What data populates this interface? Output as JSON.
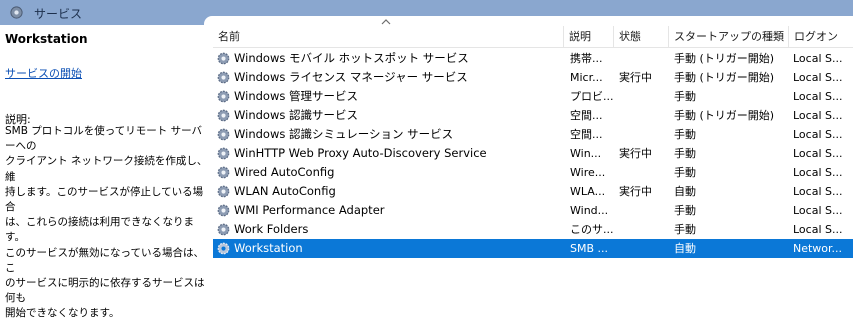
{
  "window": {
    "title": "サービス"
  },
  "left_panel": {
    "service_name": "Workstation",
    "start_link": "サービスの開始",
    "description_label": "説明:",
    "description": "SMB プロトコルを使ってリモート サーバーへの\nクライアント ネットワーク接続を作成し、維\n持します。このサービスが停止している場合\nは、これらの接続は利用できなくなります。\nこのサービスが無効になっている場合は、こ\nのサービスに明示的に依存するサービスは何も\n開始できなくなります。"
  },
  "table": {
    "columns": {
      "name": "名前",
      "description": "説明",
      "state": "状態",
      "startup": "スタートアップの種類",
      "logon": "ログオン"
    },
    "rows": [
      {
        "name": "Windows モバイル ホットスポット サービス",
        "description": "携帯...",
        "state": "",
        "startup": "手動 (トリガー開始)",
        "logon": "Local S..."
      },
      {
        "name": "Windows ライセンス マネージャー サービス",
        "description": "Micr...",
        "state": "実行中",
        "startup": "手動 (トリガー開始)",
        "logon": "Local S..."
      },
      {
        "name": "Windows 管理サービス",
        "description": "プロビ...",
        "state": "",
        "startup": "手動",
        "logon": "Local S..."
      },
      {
        "name": "Windows 認識サービス",
        "description": "空間...",
        "state": "",
        "startup": "手動 (トリガー開始)",
        "logon": "Local S..."
      },
      {
        "name": "Windows 認識シミュレーション サービス",
        "description": "空間...",
        "state": "",
        "startup": "手動",
        "logon": "Local S..."
      },
      {
        "name": "WinHTTP Web Proxy Auto-Discovery Service",
        "description": "Win...",
        "state": "実行中",
        "startup": "手動",
        "logon": "Local S..."
      },
      {
        "name": "Wired AutoConfig",
        "description": "Wire...",
        "state": "",
        "startup": "手動",
        "logon": "Local S..."
      },
      {
        "name": "WLAN AutoConfig",
        "description": "WLA...",
        "state": "実行中",
        "startup": "自動",
        "logon": "Local S..."
      },
      {
        "name": "WMI Performance Adapter",
        "description": "Wind...",
        "state": "",
        "startup": "手動",
        "logon": "Local S..."
      },
      {
        "name": "Work Folders",
        "description": "このサ...",
        "state": "",
        "startup": "手動",
        "logon": "Local S..."
      },
      {
        "name": "Workstation",
        "description": "SMB ...",
        "state": "",
        "startup": "自動",
        "logon": "Networ...",
        "selected": true
      }
    ]
  },
  "colors": {
    "titlebar": "#8aa7cf",
    "selection": "#0b78d7",
    "link": "#0b4fb4"
  },
  "icons": {
    "window": "services-gear-icon",
    "row": "service-gear-icon",
    "sort": "sort-ascending-icon"
  }
}
